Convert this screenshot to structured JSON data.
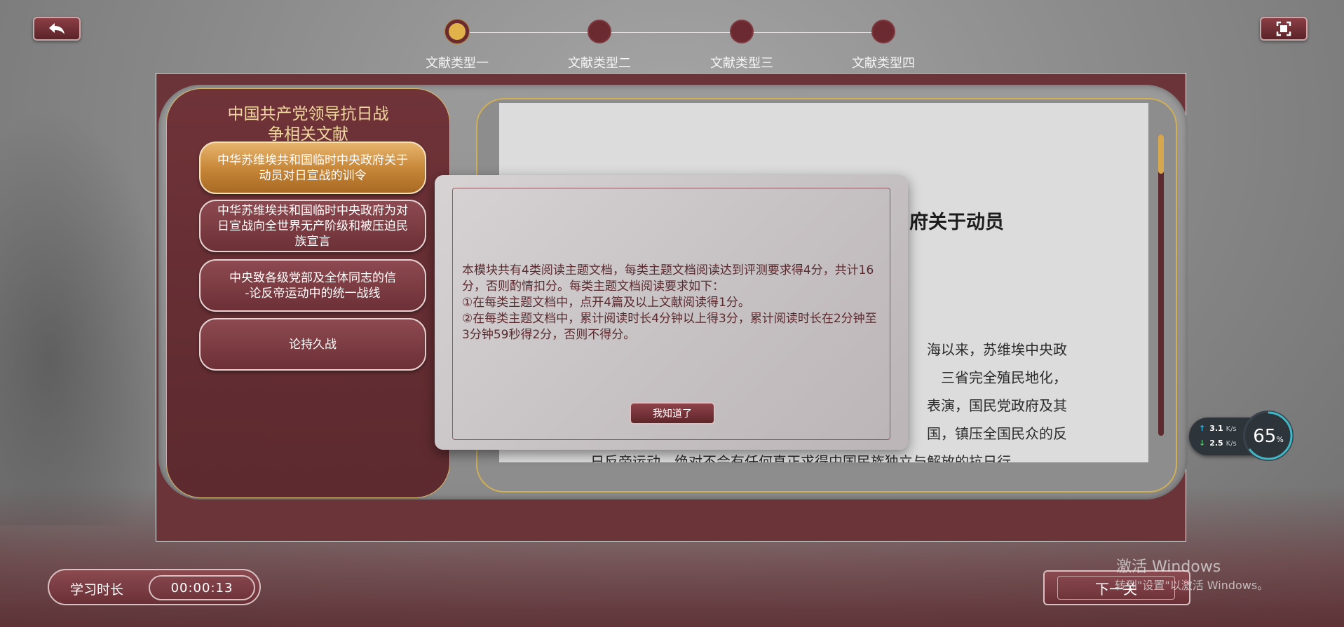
{
  "steps": [
    {
      "label": "文献类型一",
      "active": true
    },
    {
      "label": "文献类型二",
      "active": false
    },
    {
      "label": "文献类型三",
      "active": false
    },
    {
      "label": "文献类型四",
      "active": false
    }
  ],
  "left_panel": {
    "title": [
      "中国共产党领导抗日战",
      "争相关文献"
    ],
    "items": [
      {
        "lines": [
          "中华苏维埃共和国临时中央政府关于",
          "动员对日宣战的训令"
        ],
        "active": true
      },
      {
        "lines": [
          "中华苏维埃共和国临时中央政府为对",
          "日宣战向全世界无产阶级和被压迫民",
          "族宣言"
        ],
        "active": false
      },
      {
        "lines": [
          "中央致各级党部及全体同志的信",
          "-论反帝运动中的统一战线"
        ],
        "active": false
      },
      {
        "lines": [
          "论持久战"
        ],
        "active": false
      }
    ]
  },
  "reader": {
    "heading_visible": "府关于动员",
    "lines": [
      "海以来，苏维埃中央政",
      "三省完全殖民地化，",
      "表演，国民党政府及其",
      "国，镇压全国民众的反",
      "日反帝运动，绝对不会有任何真正求得中国民族独立与解放的抗日行"
    ]
  },
  "modal": {
    "paragraphs": [
      "本模块共有4类阅读主题文档，每类主题文档阅读达到评测要求得4分，共计16分，否则酌情扣分。每类主题文档阅读要求如下：",
      "①在每类主题文档中，点开4篇及以上文献阅读得1分。",
      "②在每类主题文档中，累计阅读时长4分钟以上得3分，累计阅读时长在2分钟至3分钟59秒得2分，否则不得分。"
    ],
    "confirm_label": "我知道了"
  },
  "timer": {
    "label": "学习时长",
    "value": "00:00:13"
  },
  "next_button": {
    "label": "下一关"
  },
  "watermark": {
    "title": "激活 Windows",
    "subtitle": "转到\"设置\"以激活 Windows。"
  },
  "net_widget": {
    "upload": "3.1",
    "upload_unit": "K/s",
    "download": "2.5",
    "download_unit": "K/s",
    "percent": "65",
    "percent_unit": "%"
  },
  "colors": {
    "accent_gold": "#e2b24a",
    "brand_maroon": "#6b2a30",
    "panel_maroon": "#6f3338"
  }
}
